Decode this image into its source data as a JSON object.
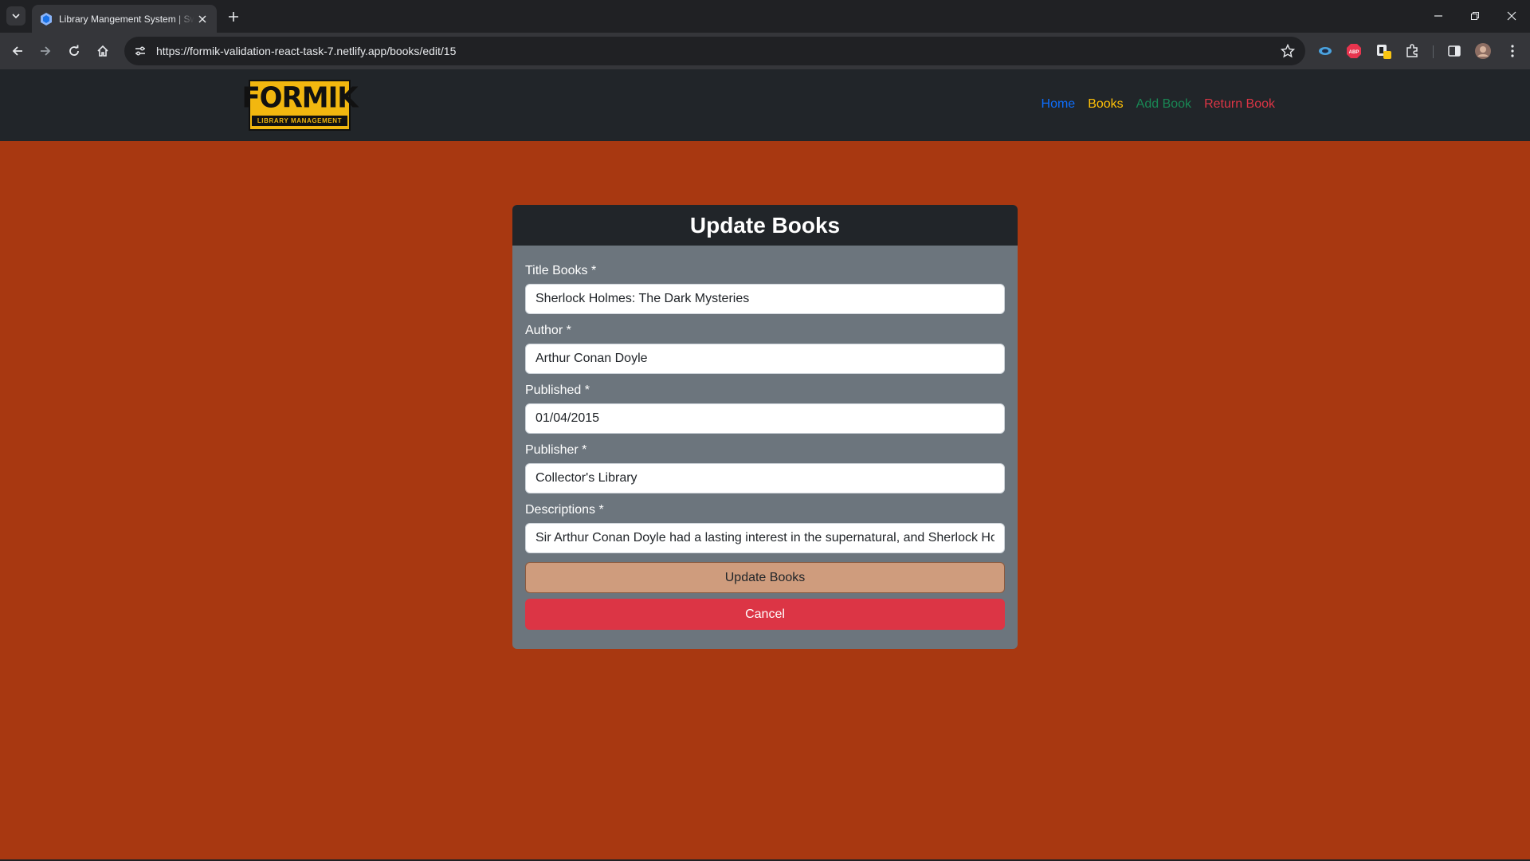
{
  "browser": {
    "tab_title": "Library Mangement System | Sw",
    "url": "https://formik-validation-react-task-7.netlify.app/books/edit/15"
  },
  "navbar": {
    "logo_main": "FORMIK",
    "logo_sub": "LIBRARY MANAGEMENT",
    "links": [
      {
        "label": "Home",
        "color": "#0d6efd"
      },
      {
        "label": "Books",
        "color": "#ffc107"
      },
      {
        "label": "Add Book",
        "color": "#198754"
      },
      {
        "label": "Return Book",
        "color": "#dc3545"
      }
    ]
  },
  "form": {
    "heading": "Update Books",
    "fields": [
      {
        "label": "Title Books *",
        "value": "Sherlock Holmes: The Dark Mysteries"
      },
      {
        "label": "Author *",
        "value": "Arthur Conan Doyle"
      },
      {
        "label": "Published *",
        "value": "01/04/2015"
      },
      {
        "label": "Publisher *",
        "value": "Collector's Library"
      },
      {
        "label": "Descriptions *",
        "value": "Sir Arthur Conan Doyle had a lasting interest in the supernatural, and Sherlock Ho"
      }
    ],
    "submit_label": "Update Books",
    "cancel_label": "Cancel"
  },
  "colors": {
    "page_bg": "#a83811",
    "card_bg": "#6c757d",
    "header_bg": "#212529",
    "update_button": "#cf9c7d",
    "cancel_button": "#dc3545"
  }
}
